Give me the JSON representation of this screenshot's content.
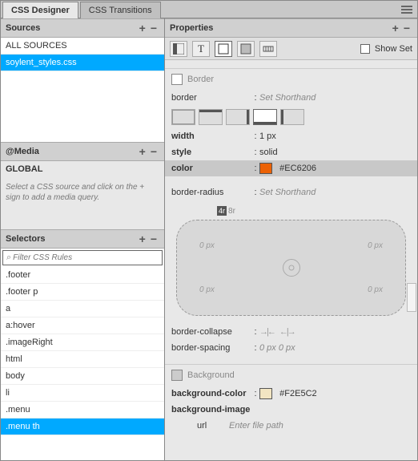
{
  "tabs": {
    "designer": "CSS Designer",
    "transitions": "CSS Transitions"
  },
  "left": {
    "sources": {
      "header": "Sources",
      "allSources": "ALL SOURCES",
      "file": "soylent_styles.css"
    },
    "media": {
      "header": "@Media",
      "global": "GLOBAL",
      "note": "Select a CSS source and click on the + sign to add a media query."
    },
    "selectors": {
      "header": "Selectors",
      "filterPlaceholder": "Filter CSS Rules",
      "items": [
        ".footer",
        ".footer p",
        "a",
        "a:hover",
        ".imageRight",
        "html",
        "body",
        "li",
        ".menu",
        ".menu th"
      ]
    }
  },
  "right": {
    "header": "Properties",
    "showSet": "Show Set",
    "border": {
      "title": "Border",
      "label": "border",
      "shorthand": "Set Shorthand",
      "width": {
        "label": "width",
        "value": "1 px"
      },
      "style": {
        "label": "style",
        "value": "solid"
      },
      "color": {
        "label": "color",
        "value": "#EC6206",
        "swatch": "#EC6206"
      },
      "radius": {
        "label": "border-radius",
        "shorthand": "Set Shorthand",
        "chip": "4r",
        "chipVal": "8r",
        "corners": {
          "tl": "0 px",
          "tr": "0 px",
          "bl": "0 px",
          "br": "0 px"
        }
      },
      "collapse": {
        "label": "border-collapse"
      },
      "spacing": {
        "label": "border-spacing",
        "value": "0 px   0 px"
      }
    },
    "background": {
      "title": "Background",
      "bgcolor": {
        "label": "background-color",
        "value": "#F2E5C2",
        "swatch": "#F2E5C2"
      },
      "bgimage": {
        "label": "background-image"
      },
      "url": {
        "label": "url",
        "placeholder": "Enter file path"
      }
    }
  }
}
